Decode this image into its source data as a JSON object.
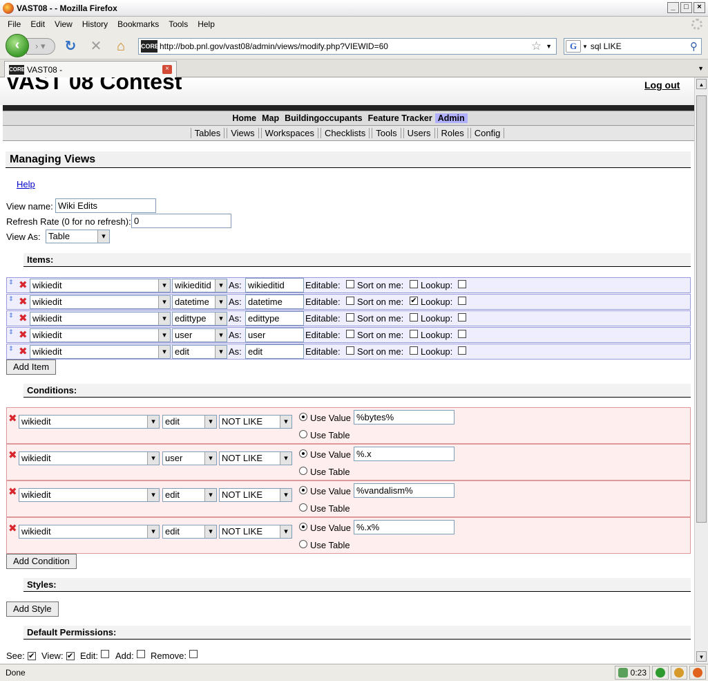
{
  "window": {
    "title": "VAST08 - - Mozilla Firefox"
  },
  "menu": [
    "File",
    "Edit",
    "View",
    "History",
    "Bookmarks",
    "Tools",
    "Help"
  ],
  "url": "http://bob.pnl.gov/vast08/admin/views/modify.php?VIEWID=60",
  "search": "sql LIKE",
  "tab": {
    "title": "VAST08 -"
  },
  "site": {
    "title": "VAST 08 Contest",
    "logout": "Log out"
  },
  "admin_nav": [
    "Home",
    "Map",
    "Buildingoccupants",
    "Feature Tracker",
    "Admin"
  ],
  "sub_nav": [
    "Tables",
    "Views",
    "Workspaces",
    "Checklists",
    "Tools",
    "Users",
    "Roles",
    "Config"
  ],
  "page": {
    "heading": "Managing Views",
    "help": "Help",
    "view_name_label": "View name:",
    "view_name": "Wiki Edits",
    "refresh_label": "Refresh Rate (0 for no refresh):",
    "refresh": "0",
    "view_as_label": "View As:",
    "view_as": "Table"
  },
  "items": {
    "heading": "Items:",
    "as_label": "As:",
    "editable_label": "Editable:",
    "sort_label": "Sort on me:",
    "lookup_label": "Lookup:",
    "add_button": "Add Item",
    "rows": [
      {
        "table": "wikiedit",
        "field": "wikieditid",
        "alias": "wikieditid",
        "editable": false,
        "sort": false,
        "lookup": false
      },
      {
        "table": "wikiedit",
        "field": "datetime",
        "alias": "datetime",
        "editable": false,
        "sort": true,
        "lookup": false
      },
      {
        "table": "wikiedit",
        "field": "edittype",
        "alias": "edittype",
        "editable": false,
        "sort": false,
        "lookup": false
      },
      {
        "table": "wikiedit",
        "field": "user",
        "alias": "user",
        "editable": false,
        "sort": false,
        "lookup": false
      },
      {
        "table": "wikiedit",
        "field": "edit",
        "alias": "edit",
        "editable": false,
        "sort": false,
        "lookup": false
      }
    ]
  },
  "conditions": {
    "heading": "Conditions:",
    "use_value_label": "Use Value",
    "use_table_label": "Use Table",
    "add_button": "Add Condition",
    "rows": [
      {
        "table": "wikiedit",
        "field": "edit",
        "op": "NOT LIKE",
        "value": "%bytes%"
      },
      {
        "table": "wikiedit",
        "field": "user",
        "op": "NOT LIKE",
        "value": "%.x"
      },
      {
        "table": "wikiedit",
        "field": "edit",
        "op": "NOT LIKE",
        "value": "%vandalism%"
      },
      {
        "table": "wikiedit",
        "field": "edit",
        "op": "NOT LIKE",
        "value": "%.x%"
      }
    ]
  },
  "styles": {
    "heading": "Styles:",
    "add_button": "Add Style"
  },
  "permissions": {
    "heading": "Default Permissions:",
    "items": [
      {
        "label": "See:",
        "checked": true
      },
      {
        "label": "View:",
        "checked": true
      },
      {
        "label": "Edit:",
        "checked": false
      },
      {
        "label": "Add:",
        "checked": false
      },
      {
        "label": "Remove:",
        "checked": false
      }
    ]
  },
  "status": {
    "text": "Done",
    "time": "0:23"
  },
  "icons": {
    "check": "✔",
    "move": "⇕",
    "remove": "✖"
  }
}
